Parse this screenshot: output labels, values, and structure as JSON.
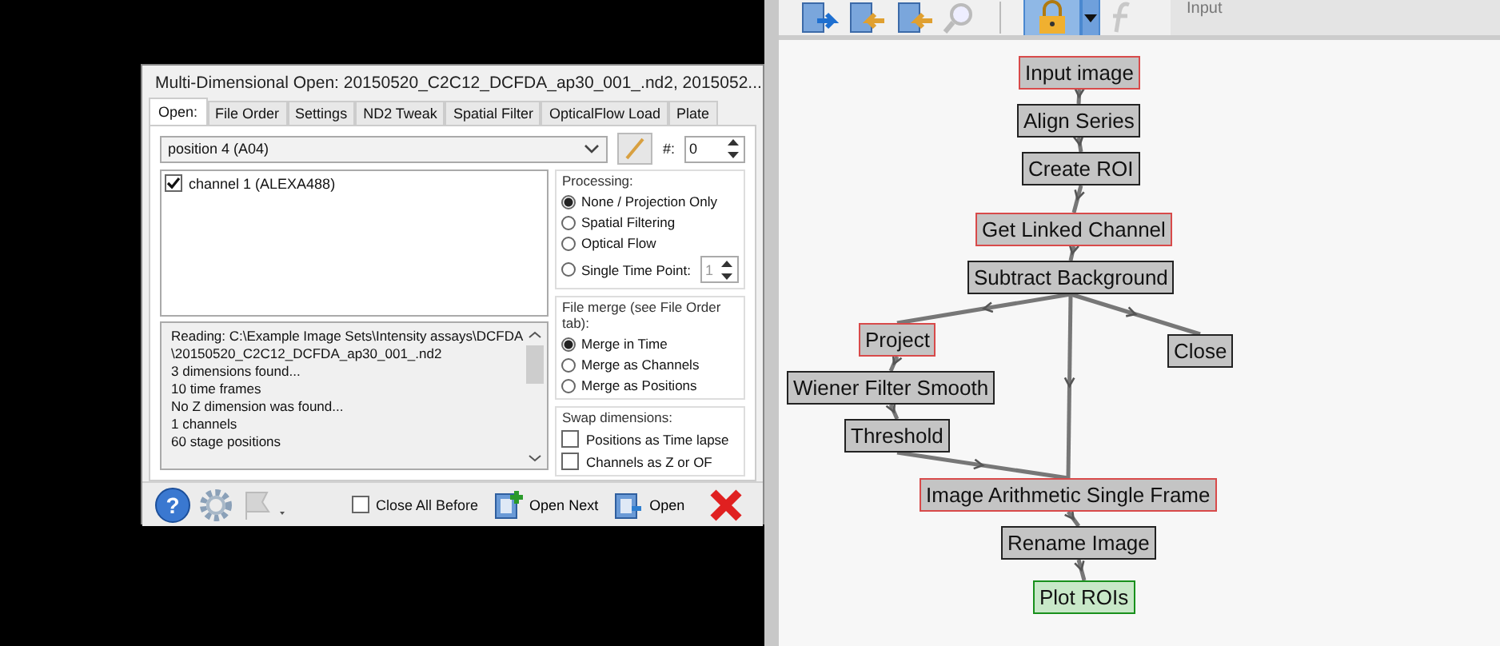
{
  "dialog": {
    "title": "Multi-Dimensional Open: 20150520_C2C12_DCFDA_ap30_001_.nd2, 2015052...",
    "tabs": [
      {
        "label": "Open:",
        "selected": true
      },
      {
        "label": "File Order",
        "selected": false
      },
      {
        "label": "Settings",
        "selected": false
      },
      {
        "label": "ND2 Tweak",
        "selected": false
      },
      {
        "label": "Spatial Filter",
        "selected": false
      },
      {
        "label": "OpticalFlow Load",
        "selected": false
      },
      {
        "label": "Plate",
        "selected": false
      }
    ],
    "position_select": {
      "value": "position 4 (A04)"
    },
    "number_label": "#:",
    "number_field": {
      "value": "0"
    },
    "channels": [
      {
        "label": "channel 1 (ALEXA488)",
        "checked": true
      }
    ],
    "log": [
      "Reading: C:\\Example Image Sets\\Intensity assays\\DCFDA",
      "\\20150520_C2C12_DCFDA_ap30_001_.nd2",
      "3 dimensions found...",
      "10 time frames",
      "No Z dimension was found...",
      "1 channels",
      "60 stage positions"
    ],
    "processing": {
      "title": "Processing:",
      "options": [
        {
          "label": "None / Projection Only",
          "selected": true
        },
        {
          "label": "Spatial Filtering",
          "selected": false
        },
        {
          "label": "Optical Flow",
          "selected": false
        },
        {
          "label": "Single Time Point:",
          "selected": false
        }
      ],
      "time_point": {
        "value": "1",
        "disabled": true
      }
    },
    "file_merge": {
      "title": "File merge (see File Order tab):",
      "options": [
        {
          "label": "Merge in Time",
          "selected": true
        },
        {
          "label": "Merge as Channels",
          "selected": false
        },
        {
          "label": "Merge as Positions",
          "selected": false
        }
      ]
    },
    "swap": {
      "title": "Swap dimensions:",
      "options": [
        {
          "label": "Positions as Time lapse",
          "checked": false
        },
        {
          "label": "Channels as Z or OF",
          "checked": false
        }
      ]
    },
    "close_all_before": {
      "label": "Close All Before",
      "checked": false
    },
    "help_button": "?",
    "buttons": [
      "Open Next",
      "Open"
    ]
  },
  "toolbar": {
    "field_text": "Input"
  },
  "workflow": {
    "nodes": [
      {
        "label": "Input image",
        "kind": "input"
      },
      {
        "label": "Align Series",
        "kind": "step"
      },
      {
        "label": "Create ROI",
        "kind": "step"
      },
      {
        "label": "Get Linked Channel",
        "kind": "input"
      },
      {
        "label": "Subtract Background",
        "kind": "step"
      },
      {
        "label": "Project",
        "kind": "input"
      },
      {
        "label": "Close",
        "kind": "step"
      },
      {
        "label": "Wiener Filter Smooth",
        "kind": "step"
      },
      {
        "label": "Threshold",
        "kind": "step"
      },
      {
        "label": "Image Arithmetic Single Frame",
        "kind": "input"
      },
      {
        "label": "Rename Image",
        "kind": "step"
      },
      {
        "label": "Plot ROIs",
        "kind": "output"
      }
    ]
  }
}
